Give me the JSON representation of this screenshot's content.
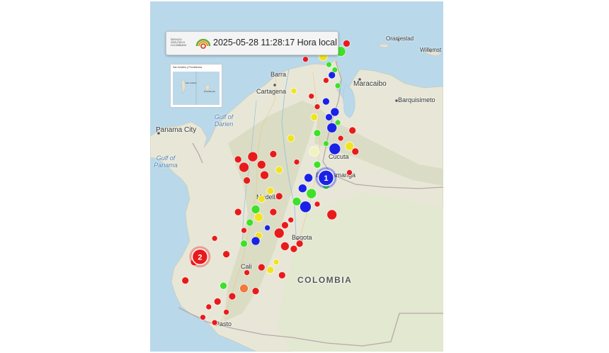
{
  "header": {
    "logo_text": "SERVICIO GEOLÓGICO COLOMBIANO",
    "timestamp": "2025-05-28 11:28:17 Hora local"
  },
  "inset": {
    "title": "San Andrés y Providencia",
    "label_a": "San Andrés",
    "label_b": "Providencia"
  },
  "places": {
    "oranjestad": "Oranjestad",
    "willemstad": "Willemst",
    "barranquilla": "Barra",
    "cartagena": "Cartagena",
    "maracaibo": "Maracaibo",
    "barquisimeto": "Barquisimeto",
    "gulf_darien": "Gulf of Darien",
    "panama_city": "Panama City",
    "gulf_panama": "Gulf of Panama",
    "cucuta": "Cúcuta",
    "bucaramanga": "Bucaramanga",
    "medellin": "Medellín",
    "bogota": "Bogota",
    "cali": "Cali",
    "pasto": "Pasto",
    "colombia": "COLOMBIA"
  },
  "legend_colors": {
    "shallow": "#e81b1b",
    "intermediate": "#f1e31f",
    "deep_green": "#3ee02a",
    "deep_blue": "#1a22e6",
    "highlight": "#f2f2c0"
  },
  "clusters": [
    {
      "label": "1",
      "color": "blue"
    },
    {
      "label": "2",
      "color": "red"
    }
  ],
  "earthquakes": [
    {
      "lat": 11.3,
      "lon": -75.1,
      "color": "yellow",
      "size": 4
    },
    {
      "lat": 11.4,
      "lon": -74.7,
      "color": "red",
      "size": 4
    },
    {
      "lat": 11.2,
      "lon": -74.2,
      "color": "red",
      "size": 6
    },
    {
      "lat": 11.1,
      "lon": -73.9,
      "color": "red",
      "size": 5
    },
    {
      "lat": 11.3,
      "lon": -73.6,
      "color": "yellow",
      "size": 4
    },
    {
      "lat": 11.5,
      "lon": -73.3,
      "color": "red",
      "size": 5
    },
    {
      "lat": 11.0,
      "lon": -73.2,
      "color": "blue",
      "size": 4
    },
    {
      "lat": 11.2,
      "lon": -72.9,
      "color": "red",
      "size": 5
    },
    {
      "lat": 10.9,
      "lon": -73.1,
      "color": "green",
      "size": 7
    },
    {
      "lat": 10.7,
      "lon": -73.7,
      "color": "yellow",
      "size": 6
    },
    {
      "lat": 10.6,
      "lon": -74.3,
      "color": "red",
      "size": 4
    },
    {
      "lat": 10.4,
      "lon": -73.5,
      "color": "green",
      "size": 4
    },
    {
      "lat": 10.2,
      "lon": -73.3,
      "color": "green",
      "size": 4
    },
    {
      "lat": 10.0,
      "lon": -73.4,
      "color": "blue",
      "size": 5
    },
    {
      "lat": 9.8,
      "lon": -73.6,
      "color": "red",
      "size": 4
    },
    {
      "lat": 9.6,
      "lon": -73.2,
      "color": "green",
      "size": 4
    },
    {
      "lat": 9.4,
      "lon": -74.7,
      "color": "yellow",
      "size": 4
    },
    {
      "lat": 9.2,
      "lon": -74.1,
      "color": "red",
      "size": 4
    },
    {
      "lat": 9.0,
      "lon": -73.6,
      "color": "blue",
      "size": 5
    },
    {
      "lat": 8.8,
      "lon": -73.9,
      "color": "red",
      "size": 4
    },
    {
      "lat": 8.6,
      "lon": -73.3,
      "color": "blue",
      "size": 6
    },
    {
      "lat": 8.4,
      "lon": -73.5,
      "color": "blue",
      "size": 5
    },
    {
      "lat": 8.4,
      "lon": -74.0,
      "color": "yellow",
      "size": 5
    },
    {
      "lat": 8.2,
      "lon": -73.2,
      "color": "green",
      "size": 4
    },
    {
      "lat": 8.0,
      "lon": -73.4,
      "color": "blue",
      "size": 7
    },
    {
      "lat": 7.9,
      "lon": -72.7,
      "color": "red",
      "size": 5
    },
    {
      "lat": 7.8,
      "lon": -73.9,
      "color": "green",
      "size": 5
    },
    {
      "lat": 7.6,
      "lon": -73.1,
      "color": "red",
      "size": 4
    },
    {
      "lat": 7.6,
      "lon": -74.8,
      "color": "yellow",
      "size": 5
    },
    {
      "lat": 7.4,
      "lon": -73.6,
      "color": "green",
      "size": 4
    },
    {
      "lat": 7.3,
      "lon": -72.8,
      "color": "yellow",
      "size": 6
    },
    {
      "lat": 7.2,
      "lon": -73.3,
      "color": "blue",
      "size": 8
    },
    {
      "lat": 7.1,
      "lon": -74.0,
      "color": "highlight",
      "size": 7
    },
    {
      "lat": 7.1,
      "lon": -72.6,
      "color": "red",
      "size": 5
    },
    {
      "lat": 7.0,
      "lon": -75.4,
      "color": "red",
      "size": 5
    },
    {
      "lat": 6.9,
      "lon": -76.1,
      "color": "red",
      "size": 7
    },
    {
      "lat": 6.8,
      "lon": -76.6,
      "color": "red",
      "size": 5
    },
    {
      "lat": 6.7,
      "lon": -74.6,
      "color": "red",
      "size": 4
    },
    {
      "lat": 6.6,
      "lon": -75.8,
      "color": "red",
      "size": 6
    },
    {
      "lat": 6.6,
      "lon": -73.9,
      "color": "green",
      "size": 5
    },
    {
      "lat": 6.5,
      "lon": -76.4,
      "color": "red",
      "size": 7
    },
    {
      "lat": 6.4,
      "lon": -75.2,
      "color": "yellow",
      "size": 5
    },
    {
      "lat": 6.3,
      "lon": -72.8,
      "color": "red",
      "size": 4
    },
    {
      "lat": 6.2,
      "lon": -75.7,
      "color": "red",
      "size": 6
    },
    {
      "lat": 6.1,
      "lon": -74.2,
      "color": "blue",
      "size": 6
    },
    {
      "lat": 6.0,
      "lon": -76.3,
      "color": "red",
      "size": 5
    },
    {
      "lat": 5.8,
      "lon": -73.6,
      "color": "green",
      "size": 5
    },
    {
      "lat": 5.7,
      "lon": -74.4,
      "color": "blue",
      "size": 6
    },
    {
      "lat": 5.6,
      "lon": -75.5,
      "color": "yellow",
      "size": 5
    },
    {
      "lat": 5.5,
      "lon": -74.1,
      "color": "green",
      "size": 7
    },
    {
      "lat": 5.4,
      "lon": -75.2,
      "color": "red",
      "size": 5
    },
    {
      "lat": 5.3,
      "lon": -75.8,
      "color": "yellow",
      "size": 5
    },
    {
      "lat": 5.2,
      "lon": -74.6,
      "color": "green",
      "size": 6
    },
    {
      "lat": 5.1,
      "lon": -73.9,
      "color": "red",
      "size": 4
    },
    {
      "lat": 5.0,
      "lon": -74.3,
      "color": "blue",
      "size": 8
    },
    {
      "lat": 4.9,
      "lon": -76.0,
      "color": "green",
      "size": 6
    },
    {
      "lat": 4.8,
      "lon": -76.6,
      "color": "red",
      "size": 5
    },
    {
      "lat": 4.8,
      "lon": -75.4,
      "color": "red",
      "size": 5
    },
    {
      "lat": 4.7,
      "lon": -73.4,
      "color": "red",
      "size": 7
    },
    {
      "lat": 4.6,
      "lon": -75.9,
      "color": "yellow",
      "size": 6
    },
    {
      "lat": 4.5,
      "lon": -74.8,
      "color": "red",
      "size": 4
    },
    {
      "lat": 4.4,
      "lon": -76.2,
      "color": "green",
      "size": 5
    },
    {
      "lat": 4.3,
      "lon": -75.0,
      "color": "red",
      "size": 5
    },
    {
      "lat": 4.2,
      "lon": -75.6,
      "color": "blue",
      "size": 4
    },
    {
      "lat": 4.1,
      "lon": -76.4,
      "color": "red",
      "size": 4
    },
    {
      "lat": 4.0,
      "lon": -75.2,
      "color": "red",
      "size": 7
    },
    {
      "lat": 3.9,
      "lon": -75.9,
      "color": "yellow",
      "size": 5
    },
    {
      "lat": 3.8,
      "lon": -77.4,
      "color": "red",
      "size": 4
    },
    {
      "lat": 3.7,
      "lon": -76.0,
      "color": "blue",
      "size": 6
    },
    {
      "lat": 3.6,
      "lon": -74.5,
      "color": "red",
      "size": 5
    },
    {
      "lat": 3.6,
      "lon": -76.4,
      "color": "green",
      "size": 5
    },
    {
      "lat": 3.5,
      "lon": -75.0,
      "color": "red",
      "size": 6
    },
    {
      "lat": 3.4,
      "lon": -74.7,
      "color": "red",
      "size": 5
    },
    {
      "lat": 3.2,
      "lon": -77.0,
      "color": "red",
      "size": 5
    },
    {
      "lat": 2.9,
      "lon": -78.1,
      "color": "red",
      "size": 5
    },
    {
      "lat": 2.9,
      "lon": -75.3,
      "color": "yellow",
      "size": 4
    },
    {
      "lat": 2.7,
      "lon": -75.8,
      "color": "red",
      "size": 5
    },
    {
      "lat": 2.6,
      "lon": -75.5,
      "color": "yellow",
      "size": 5
    },
    {
      "lat": 2.5,
      "lon": -76.3,
      "color": "red",
      "size": 4
    },
    {
      "lat": 2.4,
      "lon": -75.1,
      "color": "red",
      "size": 5
    },
    {
      "lat": 2.2,
      "lon": -78.4,
      "color": "red",
      "size": 5
    },
    {
      "lat": 2.0,
      "lon": -77.1,
      "color": "green",
      "size": 5
    },
    {
      "lat": 1.9,
      "lon": -76.4,
      "color": "orange",
      "size": 6
    },
    {
      "lat": 1.8,
      "lon": -76.0,
      "color": "red",
      "size": 5
    },
    {
      "lat": 1.6,
      "lon": -76.8,
      "color": "red",
      "size": 5
    },
    {
      "lat": 1.4,
      "lon": -77.3,
      "color": "red",
      "size": 5
    },
    {
      "lat": 1.2,
      "lon": -77.6,
      "color": "red",
      "size": 4
    },
    {
      "lat": 1.0,
      "lon": -77.0,
      "color": "red",
      "size": 4
    },
    {
      "lat": 0.8,
      "lon": -77.8,
      "color": "red",
      "size": 4
    },
    {
      "lat": 0.6,
      "lon": -77.4,
      "color": "red",
      "size": 4
    }
  ]
}
